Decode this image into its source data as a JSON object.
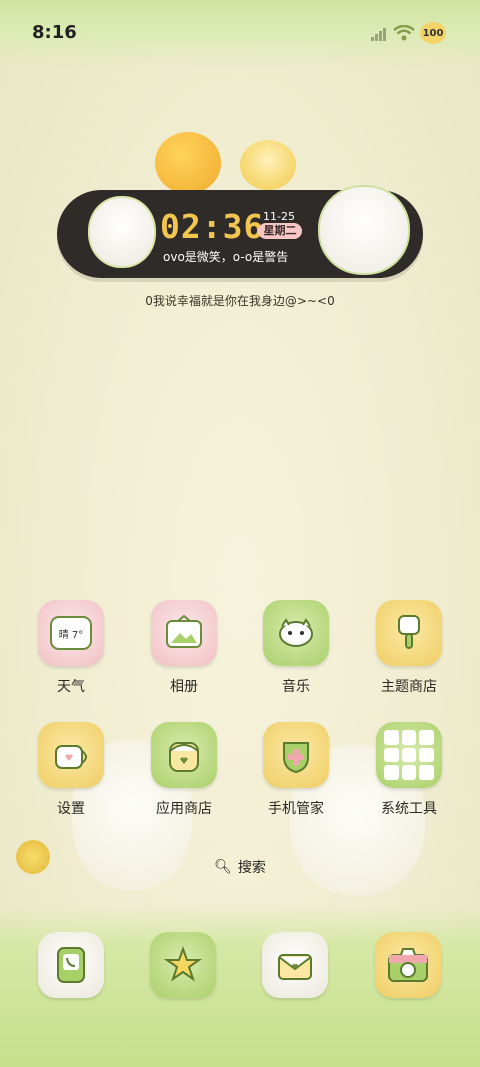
{
  "status_bar": {
    "time": "8:16",
    "battery": "100"
  },
  "clock_widget": {
    "time": "02:36",
    "date": "11-25",
    "weekday": "星期二",
    "motto": "ovo是微笑，o-o是警告",
    "caption": "0我说幸福就是你在我身边@>~<0"
  },
  "apps": [
    {
      "label": "天气",
      "icon": "weather-icon",
      "badge": "晴 7°"
    },
    {
      "label": "相册",
      "icon": "gallery-icon"
    },
    {
      "label": "音乐",
      "icon": "music-icon"
    },
    {
      "label": "主题商店",
      "icon": "theme-store-icon"
    },
    {
      "label": "设置",
      "icon": "settings-icon"
    },
    {
      "label": "应用商店",
      "icon": "app-store-icon"
    },
    {
      "label": "手机管家",
      "icon": "phone-manager-icon"
    },
    {
      "label": "系统工具",
      "icon": "system-tools-folder-icon"
    }
  ],
  "search": {
    "label": "搜索"
  },
  "dock": [
    {
      "icon": "phone-icon"
    },
    {
      "icon": "star-icon"
    },
    {
      "icon": "mail-icon"
    },
    {
      "icon": "camera-icon"
    }
  ],
  "colors": {
    "clock_bg": "#2e2b28",
    "clock_digits": "#f2c54f",
    "weekday_badge": "#f6c7c4",
    "grass": "#c6df8c"
  }
}
